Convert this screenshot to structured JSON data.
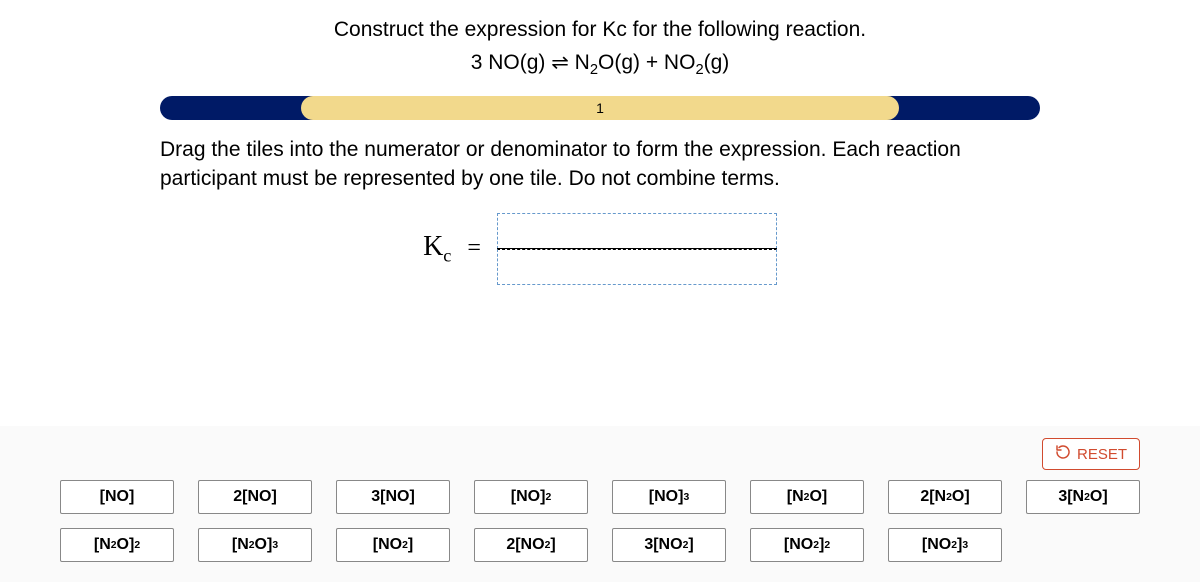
{
  "prompt": "Construct the expression for Kc for the following reaction.",
  "equation_html": "3 NO(g) <span class='equil'>⇌</span> N<sub>2</sub>O(g) + NO<sub>2</sub>(g)",
  "progress": {
    "label": "1",
    "left_pct": 16,
    "width_pct": 68
  },
  "instructions": "Drag the tiles into the numerator or denominator to form the expression. Each reaction participant must be represented by one tile. Do not combine terms.",
  "kc_label_html": "K<sub>c</sub>",
  "equals": "=",
  "reset_label": "RESET",
  "tiles": [
    {
      "html": "[NO]"
    },
    {
      "html": "2[NO]"
    },
    {
      "html": "3[NO]"
    },
    {
      "html": "[NO]<sup>2</sup>"
    },
    {
      "html": "[NO]<sup>3</sup>"
    },
    {
      "html": "[N<sub>2</sub>O]"
    },
    {
      "html": "2[N<sub>2</sub>O]"
    },
    {
      "html": "3[N<sub>2</sub>O]"
    },
    {
      "html": "[N<sub>2</sub>O]<sup>2</sup>"
    },
    {
      "html": "[N<sub>2</sub>O]<sup>3</sup>"
    },
    {
      "html": "[NO<sub>2</sub>]"
    },
    {
      "html": "2[NO<sub>2</sub>]"
    },
    {
      "html": "3[NO<sub>2</sub>]"
    },
    {
      "html": "[NO<sub>2</sub>]<sup>2</sup>"
    },
    {
      "html": "[NO<sub>2</sub>]<sup>3</sup>"
    },
    {
      "html": "",
      "empty": true
    }
  ]
}
